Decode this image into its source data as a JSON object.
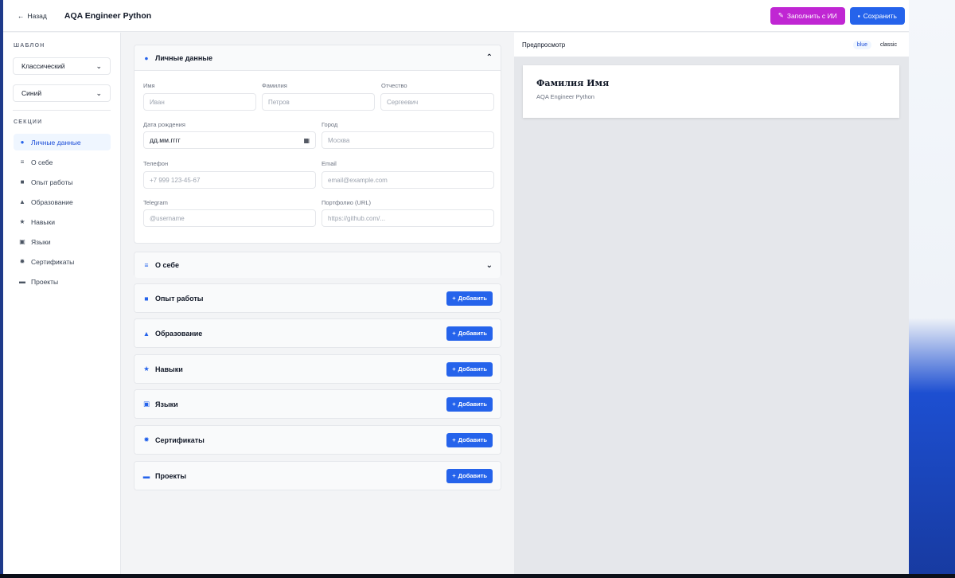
{
  "header": {
    "back_label": "Назад",
    "title": "AQA Engineer Python",
    "ai_button": "Заполнить с ИИ",
    "save_button": "Сохранить"
  },
  "sidebar": {
    "template_label": "ШАБЛОН",
    "template_value": "Классический",
    "color_value": "Синий",
    "sections_label": "СЕКЦИИ",
    "items": [
      {
        "label": "Личные данные",
        "icon": "user-icon"
      },
      {
        "label": "О себе",
        "icon": "text-lines-icon"
      },
      {
        "label": "Опыт работы",
        "icon": "briefcase-icon"
      },
      {
        "label": "Образование",
        "icon": "graduation-cap-icon"
      },
      {
        "label": "Навыки",
        "icon": "star-icon"
      },
      {
        "label": "Языки",
        "icon": "id-card-icon"
      },
      {
        "label": "Сертификаты",
        "icon": "certificate-icon"
      },
      {
        "label": "Проекты",
        "icon": "folder-icon"
      }
    ]
  },
  "personal": {
    "title": "Личные данные",
    "first_name_label": "Имя",
    "first_name_ph": "Иван",
    "last_name_label": "Фамилия",
    "last_name_ph": "Петров",
    "middle_name_label": "Отчество",
    "middle_name_ph": "Сергеевич",
    "birth_label": "Дата рождения",
    "birth_value": "дд.мм.гггг",
    "city_label": "Город",
    "city_ph": "Москва",
    "phone_label": "Телефон",
    "phone_ph": "+7 999 123-45-67",
    "email_label": "Email",
    "email_ph": "email@example.com",
    "telegram_label": "Telegram",
    "telegram_ph": "@username",
    "portfolio_label": "Портфолио (URL)",
    "portfolio_ph": "https://github.com/..."
  },
  "about": {
    "title": "О себе"
  },
  "sections": [
    {
      "title": "Опыт работы",
      "icon": "briefcase-icon"
    },
    {
      "title": "Образование",
      "icon": "graduation-cap-icon"
    },
    {
      "title": "Навыки",
      "icon": "star-icon"
    },
    {
      "title": "Языки",
      "icon": "id-card-icon"
    },
    {
      "title": "Сертификаты",
      "icon": "certificate-icon"
    },
    {
      "title": "Проекты",
      "icon": "folder-icon"
    }
  ],
  "add_label": "Добавить",
  "preview": {
    "label": "Предпросмотр",
    "tag_color": "blue",
    "tag_template": "classic",
    "name": "Фамилия Имя",
    "position": "AQA Engineer Python"
  },
  "colors": {
    "accent": "#2563eb",
    "ai": "#c026d3"
  }
}
